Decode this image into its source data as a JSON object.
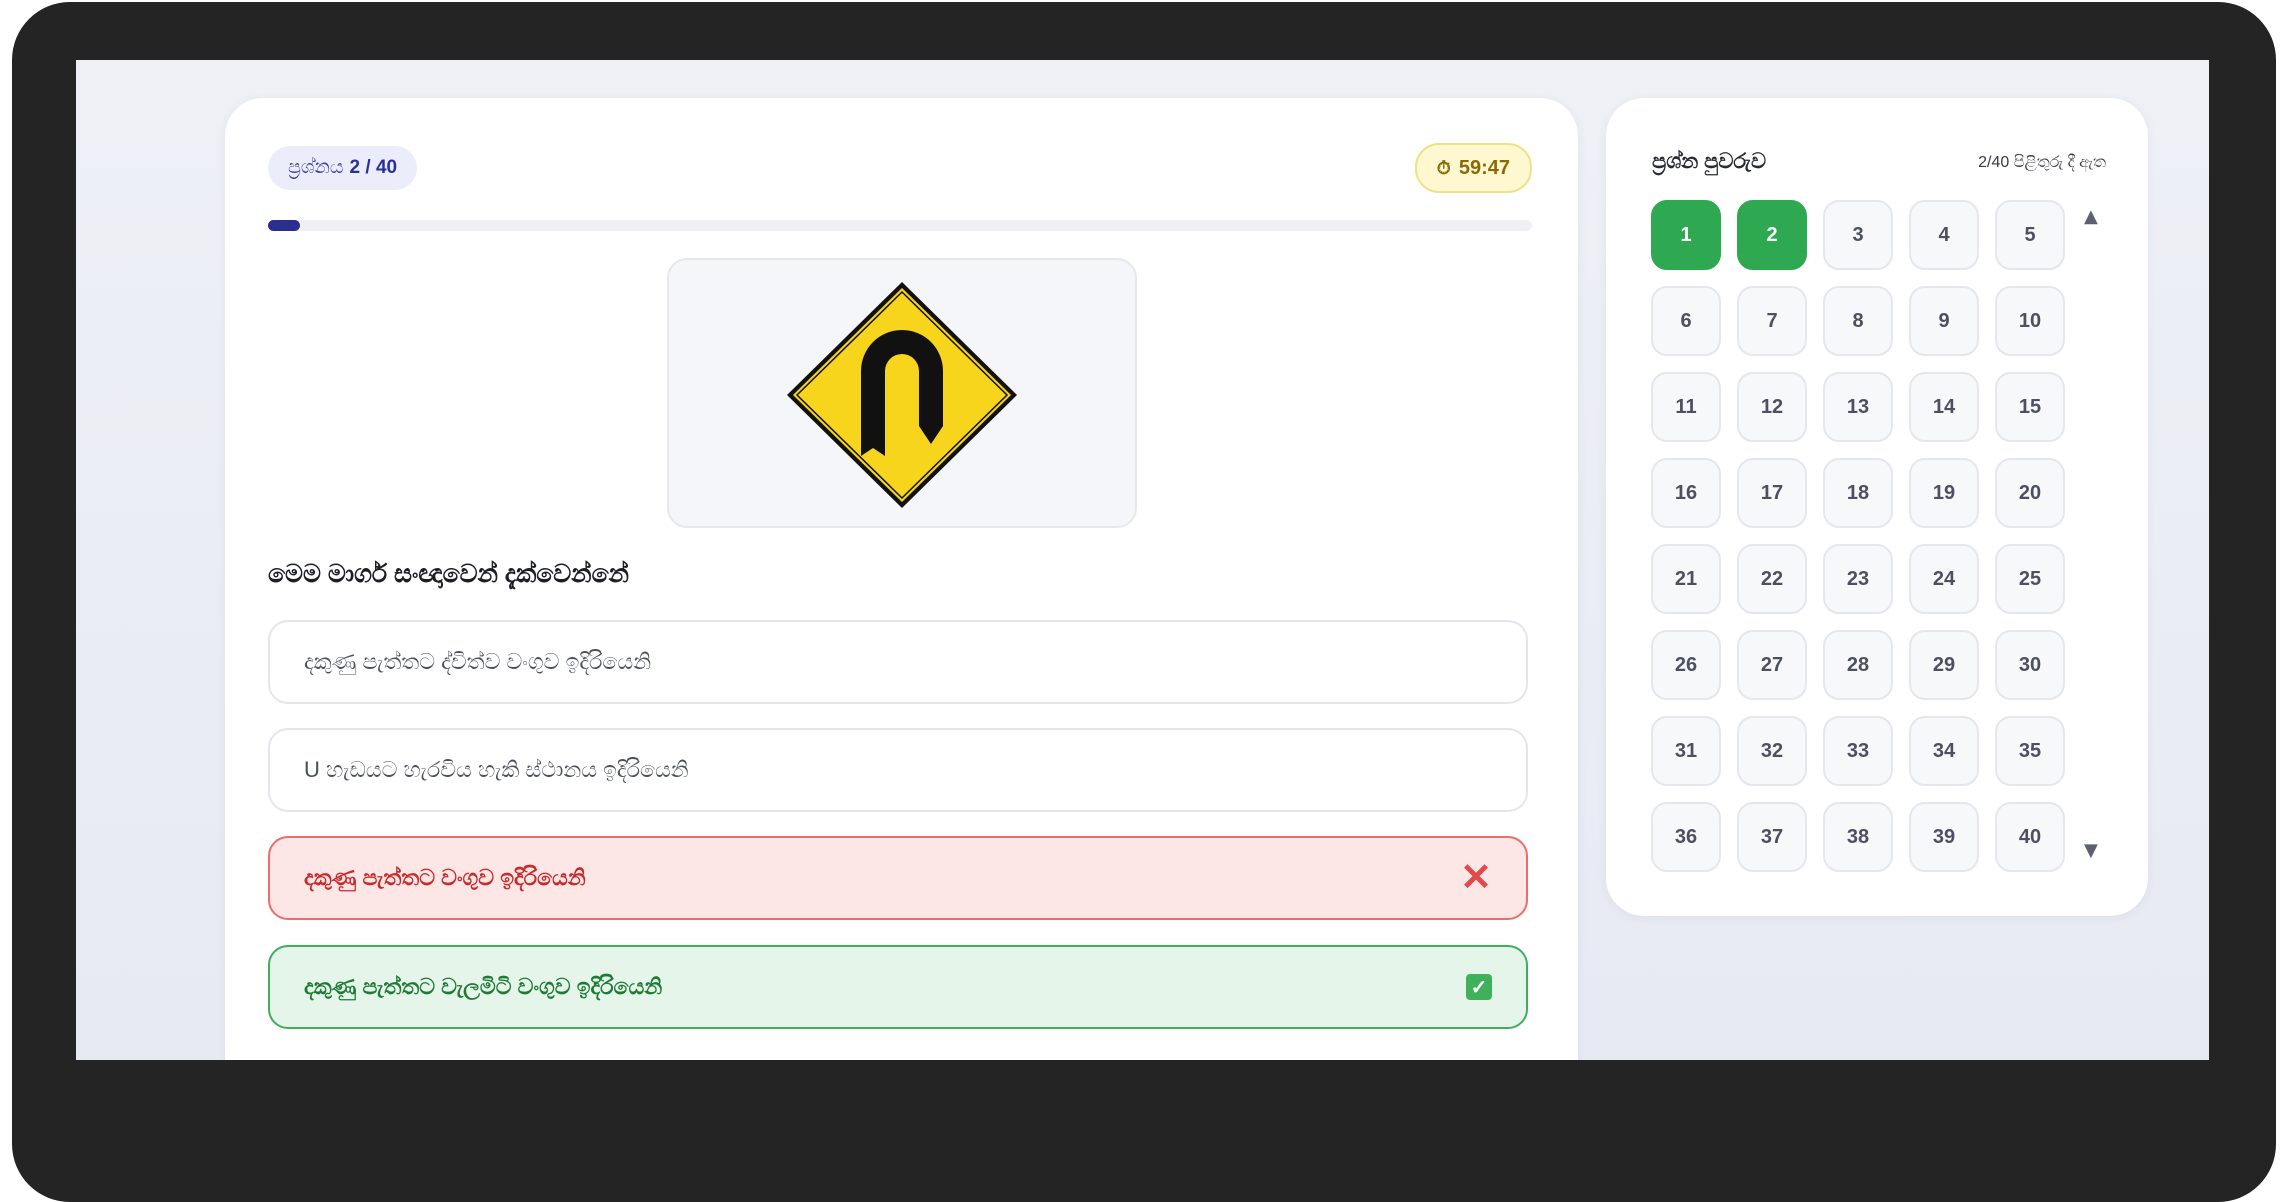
{
  "question": {
    "label": "ප්‍රශ්නය",
    "number": "2 / 40",
    "timer_icon": "stopwatch-icon",
    "timer": "59:47",
    "progress": 0.025,
    "sign_image": "u-turn-road-sign",
    "text": "මෙම මාර්ග සංඥාවෙන් දැක්වෙන්නේ",
    "options": [
      {
        "text": "දකුණු පැත්තට ද්විත්ව වංගුව ඉදිරියෙනි",
        "state": "default"
      },
      {
        "text": "U හැඩයට හැරවිය හැකි ස්ථානය ඉදිරියෙනි",
        "state": "default"
      },
      {
        "text": "දකුණු පැත්තට වංගුව ඉදිරියෙනි",
        "state": "wrong",
        "icon": "x-icon"
      },
      {
        "text": "දකුණු පැත්තට වැලමිටි වංගුව ඉදිරියෙනි",
        "state": "correct",
        "icon": "check-icon"
      }
    ]
  },
  "navigator": {
    "title": "ප්‍රශ්න පුවරුව",
    "status": "2/40 පිළිතුරු දී ඇත",
    "numbers": [
      "1",
      "2",
      "3",
      "4",
      "5",
      "6",
      "7",
      "8",
      "9",
      "10",
      "11",
      "12",
      "13",
      "14",
      "15",
      "16",
      "17",
      "18",
      "19",
      "20",
      "21",
      "22",
      "23",
      "24",
      "25",
      "26",
      "27",
      "28",
      "29",
      "30",
      "31",
      "32",
      "33",
      "34",
      "35",
      "36",
      "37",
      "38",
      "39",
      "40"
    ],
    "answered": [
      1,
      2
    ],
    "scroll_up": "▲",
    "scroll_down": "▼"
  },
  "colors": {
    "accent": "#2a2f8f",
    "answered": "#2ea851",
    "wrong": "#e24a4a",
    "correct": "#3fae5f",
    "timer_bg": "#fdf8cf"
  }
}
